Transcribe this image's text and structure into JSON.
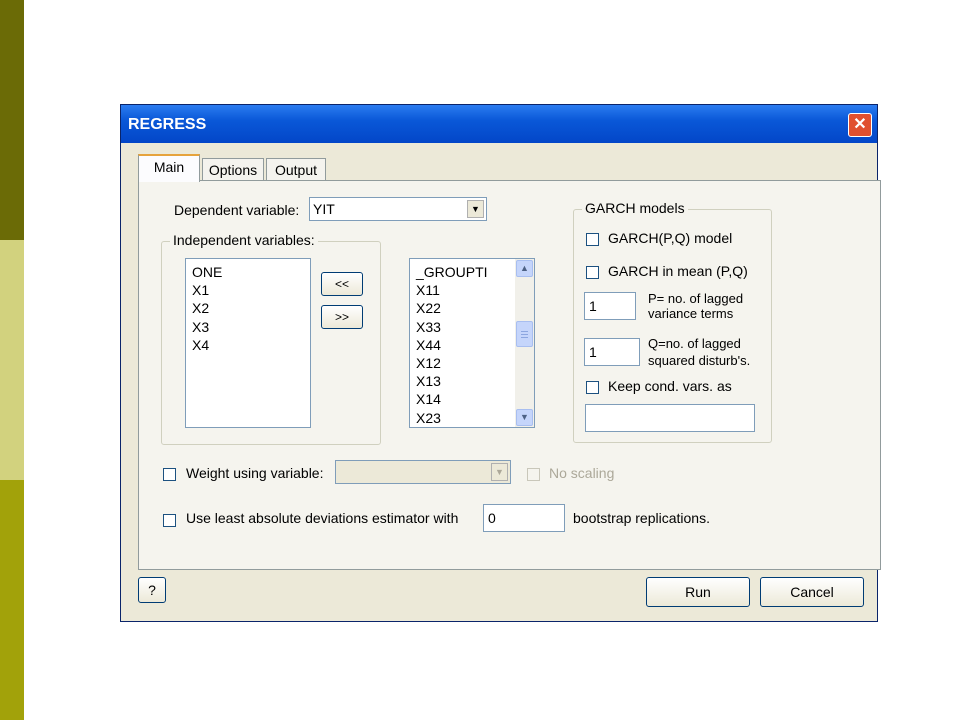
{
  "dialog": {
    "title": "REGRESS",
    "close_glyph": "✕",
    "tabs": [
      "Main",
      "Options",
      "Output"
    ],
    "dependent_label": "Dependent variable:",
    "dependent_value": "YIT",
    "independent_group_label": "Independent variables:",
    "selected_vars": [
      "ONE",
      "X1",
      "X2",
      "X3",
      "X4"
    ],
    "move_left_label": "<<",
    "move_right_label": ">>",
    "available_vars": [
      "_GROUPTI",
      "X11",
      "X22",
      "X33",
      "X44",
      "X12",
      "X13",
      "X14",
      "X23"
    ],
    "scroll_up_glyph": "▲",
    "scroll_down_glyph": "▼",
    "combo_arrow_glyph": "▼",
    "garch": {
      "group_label": "GARCH models",
      "pq_model_label": "GARCH(P,Q) model",
      "in_mean_label": "GARCH in mean (P,Q)",
      "p_value": "1",
      "p_label_line1": "P= no. of lagged",
      "p_label_line2": "variance terms",
      "q_value": "1",
      "q_label_line1": "Q=no. of lagged",
      "q_label_line2": "squared disturb's.",
      "keep_cond_label": "Keep cond. vars. as",
      "keep_cond_value": ""
    },
    "weight_label": "Weight using variable:",
    "weight_value": "",
    "no_scaling_label": "No scaling",
    "lad_label": "Use least absolute deviations estimator with",
    "lad_value": "0",
    "bootstrap_label": "bootstrap replications.",
    "help_label": "?",
    "run_label": "Run",
    "cancel_label": "Cancel"
  }
}
